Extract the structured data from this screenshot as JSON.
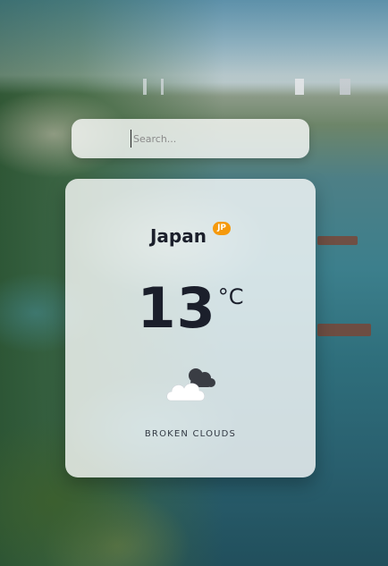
{
  "search": {
    "placeholder": "Search...",
    "value": ""
  },
  "weather": {
    "city": "Japan",
    "country_code": "JP",
    "temperature": "13",
    "unit": "°C",
    "description": "BROKEN CLOUDS",
    "icon": "broken-clouds-icon"
  },
  "colors": {
    "badge": "#f5990c",
    "text": "#1b1f2b"
  }
}
